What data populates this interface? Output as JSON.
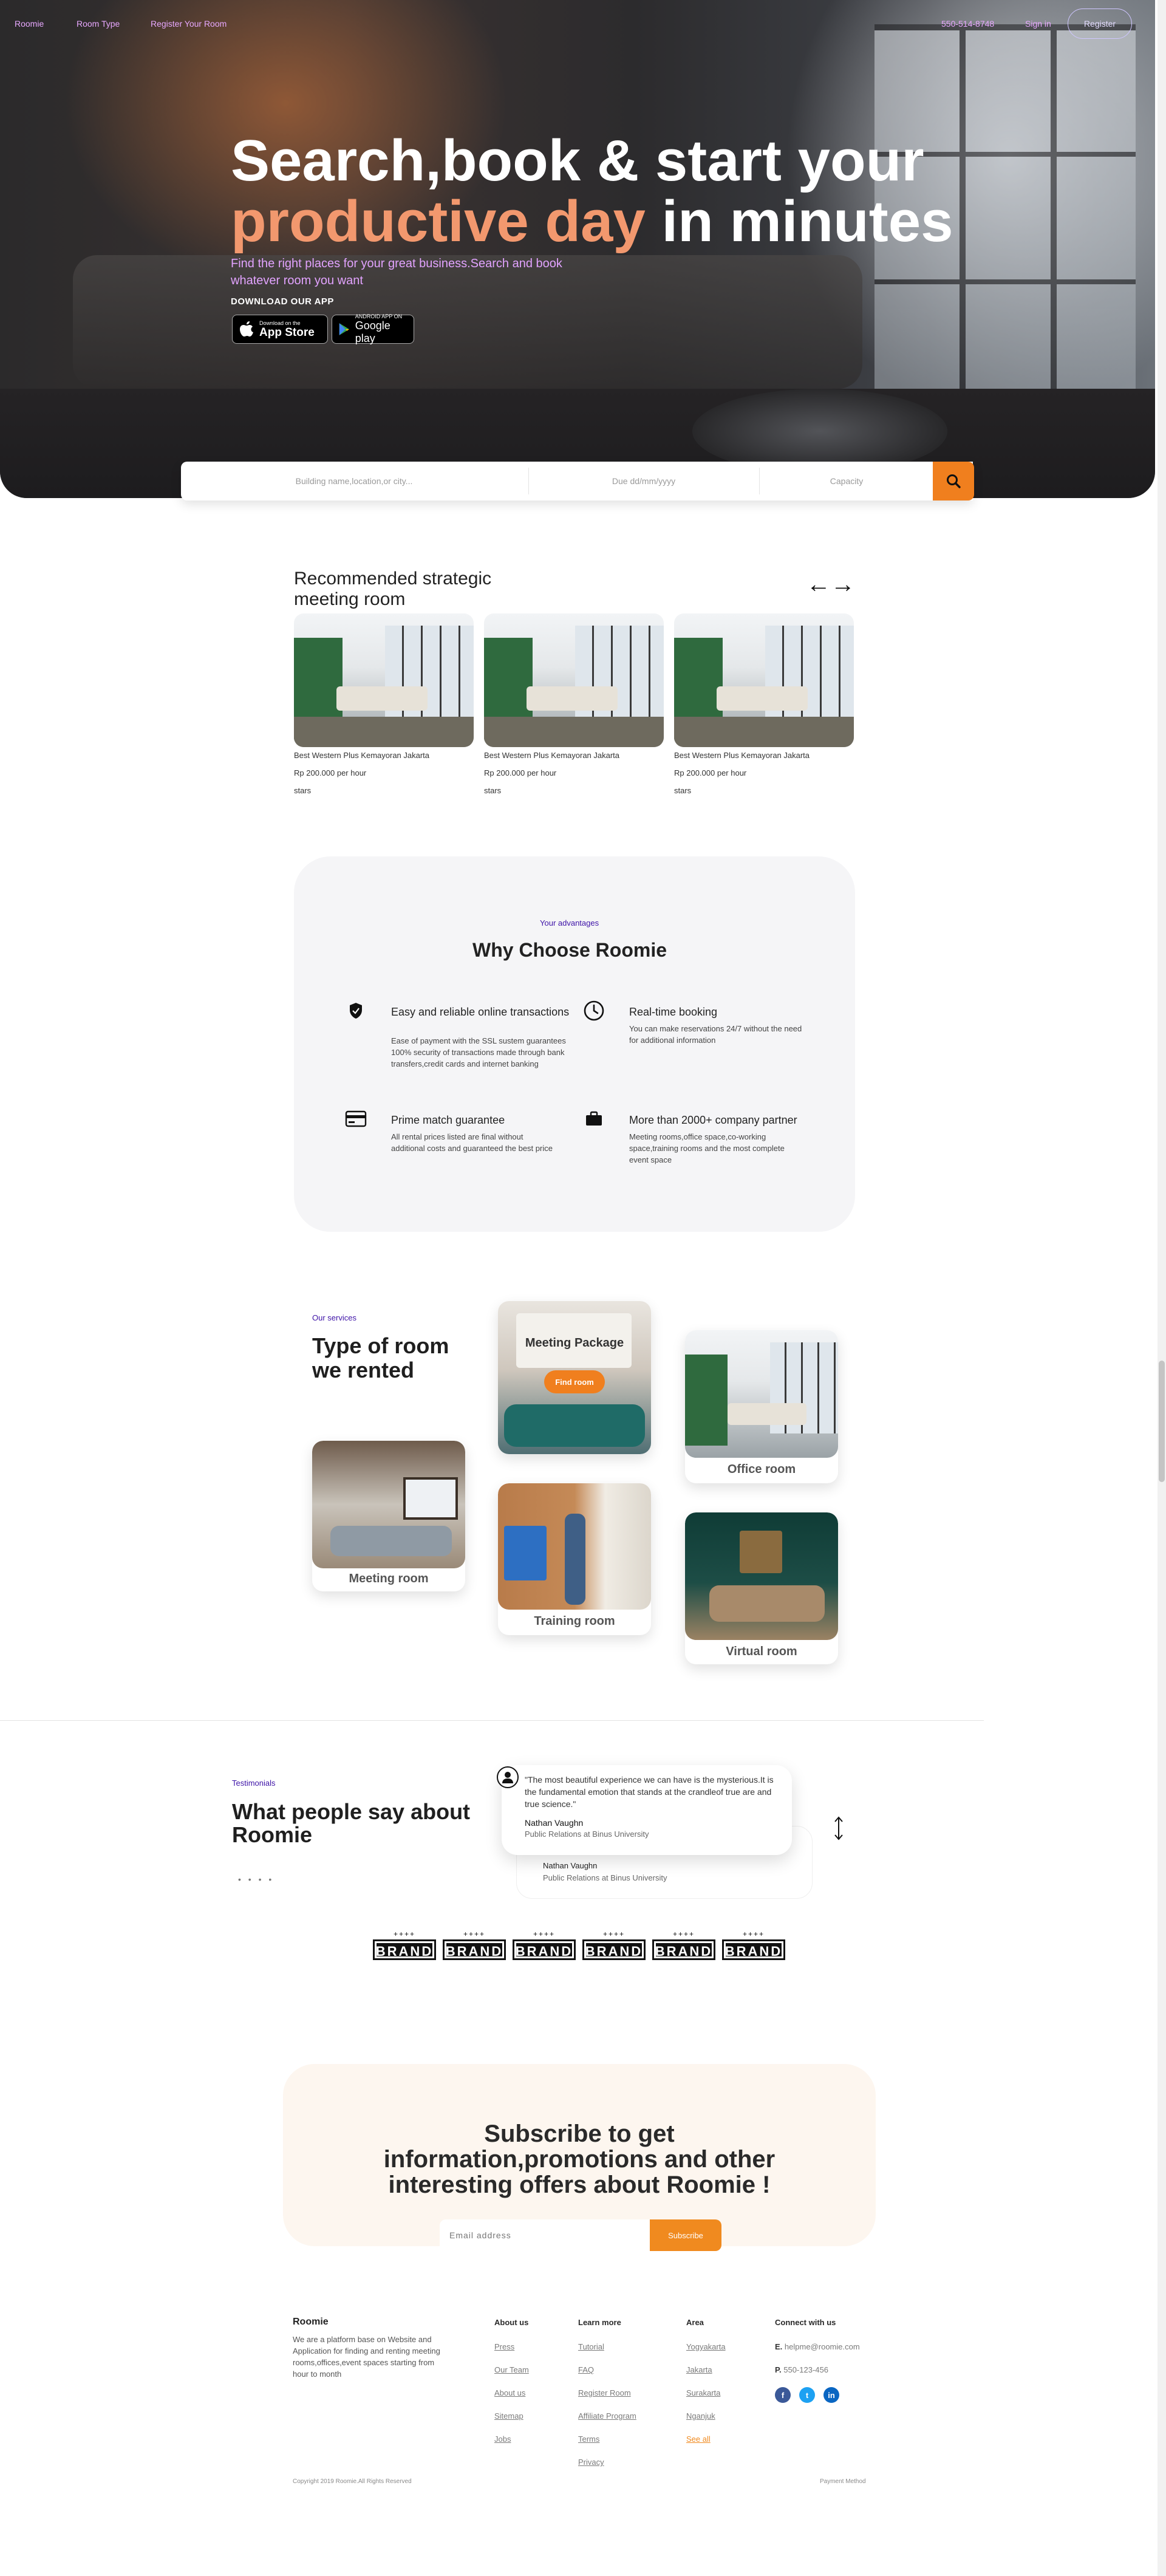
{
  "nav": {
    "brand": "Roomie",
    "room_type": "Room Type",
    "register_room": "Register Your Room",
    "phone": "550-514-8748",
    "sign_in": "Sign in",
    "register": "Register"
  },
  "hero": {
    "line1": "Search,book & start your",
    "line2_orange": "productive day",
    "line2_rest": " in minutes",
    "subtitle": "Find the right places for your great business.Search and book whatever room you want",
    "download_label": "DOWNLOAD OUR APP",
    "app_store_small": "Download on the",
    "app_store_big": "App Store",
    "google_small": "ANDROID APP ON",
    "google_big": "Google play",
    "accent_color": "#f2986e"
  },
  "search": {
    "location_placeholder": "Building name,location,or city...",
    "date_placeholder": "Due dd/mm/yyyy",
    "capacity_placeholder": "Capacity",
    "button_icon": "search-icon",
    "button_color": "#f07f1e"
  },
  "recommended": {
    "title_line1": "Recommended strategic",
    "title_line2": "meeting room",
    "prev_icon": "arrow-left-icon",
    "next_icon": "arrow-right-icon",
    "cards": [
      {
        "name": "Best Western Plus Kemayoran Jakarta",
        "price": "Rp 200.000 per hour",
        "rating": "stars"
      },
      {
        "name": "Best Western Plus Kemayoran Jakarta",
        "price": "Rp 200.000 per hour",
        "rating": "stars"
      },
      {
        "name": "Best Western Plus Kemayoran Jakarta",
        "price": "Rp 200.000 per hour",
        "rating": "stars"
      }
    ]
  },
  "advantages": {
    "eyebrow": "Your advantages",
    "title": "Why Choose Roomie",
    "features": [
      {
        "icon": "shield-icon",
        "title": "Easy and reliable online transactions",
        "desc": "Ease of payment with the SSL sustem guarantees 100% security of transactions made through bank transfers,credit cards and internet banking"
      },
      {
        "icon": "clock-icon",
        "title": "Real-time booking",
        "desc": "You can make reservations 24/7 without the need for additional information"
      },
      {
        "icon": "credit-card-icon",
        "title": "Prime match guarantee",
        "desc": "All rental prices listed are final without additional costs and guaranteed the best price"
      },
      {
        "icon": "briefcase-icon",
        "title": "More than 2000+ company partner",
        "desc": "Meeting rooms,office space,co-working space,training rooms and the most complete event space"
      }
    ]
  },
  "services": {
    "eyebrow": "Our services",
    "title_line1": "Type of room",
    "title_line2": "we rented",
    "package_label": "Meeting Package",
    "find_room": "Find room",
    "rooms": [
      "Meeting room",
      "Training room",
      "Office room",
      "Virtual room"
    ]
  },
  "testimonials": {
    "eyebrow": "Testimonials",
    "title_line1": "What people say about",
    "title_line2": "Roomie",
    "quote": "\"The most beautiful experience we can have is the mysterious.It is the fundamental emotion that stands at the crandleof true are and true science.\"",
    "author": "Nathan Vaughn",
    "role": "Public Relations at Binus University",
    "back_author": "Nathan Vaughn",
    "back_role": "Public Relations at Binus University",
    "dots": "• • • •",
    "nav_icon": "up-down-arrows-icon"
  },
  "brands": {
    "label": "BRAND",
    "count": 6
  },
  "subscribe": {
    "title": "Subscribe to get information,promotions and other interesting offers about Roomie !",
    "email_placeholder": "Email address",
    "button": "Subscribe"
  },
  "footer": {
    "brand": "Roomie",
    "about": "We are a platform base on Website and Application for finding and renting meeting rooms,offices,event spaces starting from hour to month",
    "about_us": {
      "heading": "About us",
      "links": [
        "Press",
        "Our Team",
        "About us",
        "Sitemap",
        "Jobs"
      ]
    },
    "learn_more": {
      "heading": "Learn more",
      "links": [
        "Tutorial",
        "FAQ",
        "Register Room",
        "Affiliate Program",
        "Terms",
        "Privacy"
      ]
    },
    "area": {
      "heading": "Area",
      "links": [
        "Yogyakarta",
        "Jakarta",
        "Surakarta",
        "Nganjuk"
      ],
      "see_all": "See all"
    },
    "connect": {
      "heading": "Connect with us",
      "email_label": "E.",
      "email": "helpme@roomie.com",
      "phone_label": "P.",
      "phone": "550-123-456"
    },
    "copyright": "Copyright 2019 Roomie.All Rights Reserved",
    "payment": "Payment Method"
  }
}
